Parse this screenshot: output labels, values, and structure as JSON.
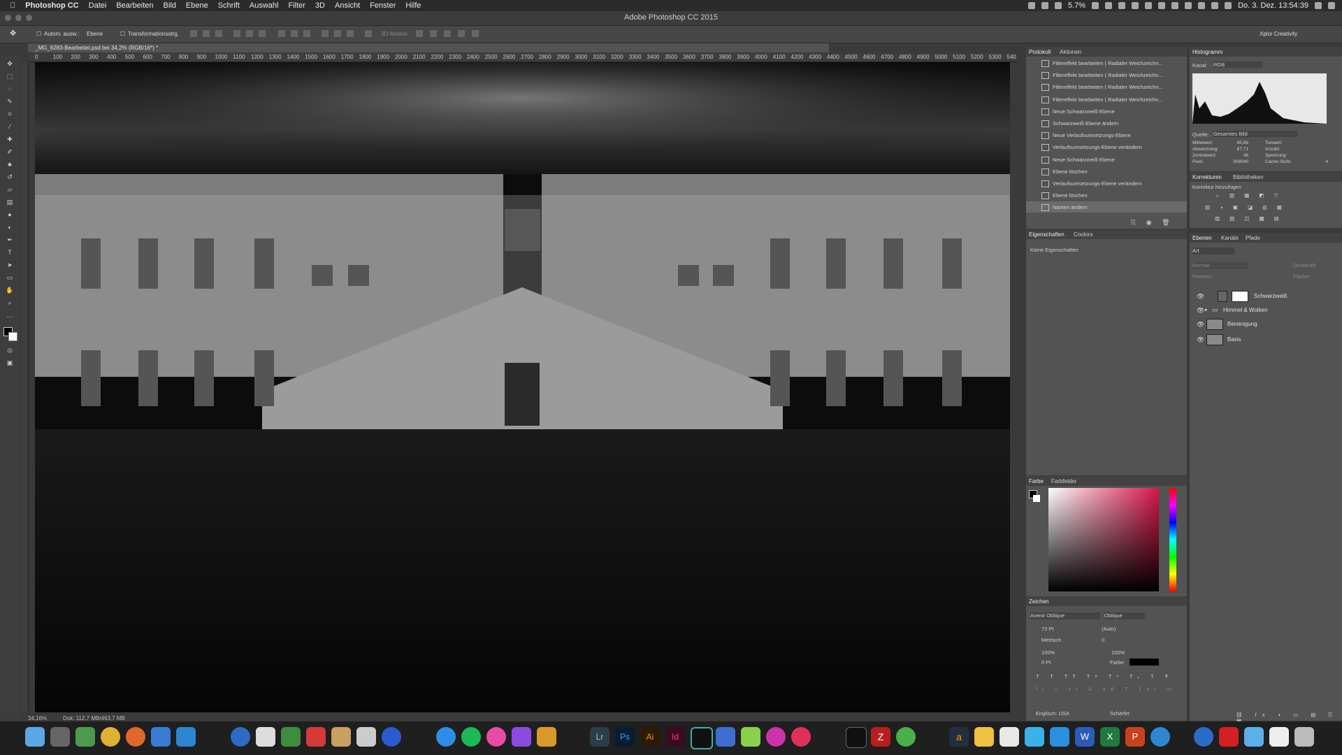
{
  "menubar": {
    "apple": "",
    "app": "Photoshop CC",
    "items": [
      "Datei",
      "Bearbeiten",
      "Bild",
      "Ebene",
      "Schrift",
      "Auswahl",
      "Filter",
      "3D",
      "Ansicht",
      "Fenster",
      "Hilfe"
    ],
    "battery": "5.7%",
    "datetime": "Do. 3. Dez.  13:54:39"
  },
  "window": {
    "title": "Adobe Photoshop CC 2015"
  },
  "options": {
    "auto_select": "Autom. ausw.:",
    "auto_select_value": "Ebene",
    "transform": "Transformationsstrg.",
    "mode3d": "3D-Modus:",
    "workspace": "Xplor Creativity"
  },
  "document": {
    "tab": "_MG_6283-Bearbeitet.psd bei 34,2% (RGB/16*) *",
    "zoom": "34,16%",
    "doc_info": "Dok: 112,7 MB/463,7 MB"
  },
  "ruler": {
    "h": [
      "0",
      "100",
      "200",
      "300",
      "400",
      "500",
      "600",
      "700",
      "800",
      "900",
      "1000",
      "1100",
      "1200",
      "1300",
      "1400",
      "1500",
      "1600",
      "1700",
      "1800",
      "1900",
      "2000",
      "2100",
      "2200",
      "2300",
      "2400",
      "2500",
      "2600",
      "2700",
      "2800",
      "2900",
      "3000",
      "3100",
      "3200",
      "3300",
      "3400",
      "3500",
      "3600",
      "3700",
      "3800",
      "3900",
      "4000",
      "4100",
      "4200",
      "4300",
      "4400",
      "4500",
      "4600",
      "4700",
      "4800",
      "4900",
      "5000",
      "5100",
      "5200",
      "5300",
      "540"
    ]
  },
  "history_panel": {
    "tabs": [
      "Protokoll",
      "Aktionen"
    ],
    "items": [
      "Filtereffekt bearbeiten ( Radialer Weichzeichn...",
      "Filtereffekt bearbeiten ( Radialer Weichzeichn...",
      "Filtereffekt bearbeiten ( Radialer Weichzeichn...",
      "Filtereffekt bearbeiten ( Radialer Weichzeichn...",
      "Neue Schwarzweiß-Ebene",
      "Schwarzweiß-Ebene ändern",
      "Neue Verlaufsumsetzungs-Ebene",
      "Verlaufsumsetzungs-Ebene verändern",
      "Neue Schwarzweiß-Ebene",
      "Ebene löschen",
      "Verlaufsumsetzungs-Ebene verändern",
      "Ebene löschen",
      "Namen ändern"
    ]
  },
  "properties_panel": {
    "tabs": [
      "Eigenschaften",
      "Coolors"
    ],
    "text": "Keine Eigenschaften"
  },
  "histogram_panel": {
    "title": "Histogramm",
    "channel_label": "Kanal:",
    "channel": "RGB",
    "source_label": "Quelle:",
    "source": "Gesamtes Bild",
    "stats_left": [
      [
        "Mittelwert:",
        "65,66"
      ],
      [
        "Abweichung:",
        "67,71"
      ],
      [
        "Zentralwert:",
        "48"
      ],
      [
        "Pixel:",
        "308040"
      ]
    ],
    "stats_right": [
      [
        "Tonwert:",
        ""
      ],
      [
        "Anzahl:",
        ""
      ],
      [
        "Spreizung:",
        ""
      ],
      [
        "Cache-Stufe:",
        "4"
      ]
    ]
  },
  "adjustments_panel": {
    "tabs": [
      "Korrekturen",
      "Bibliotheken"
    ],
    "text": "Korrektur hinzufügen"
  },
  "layers_panel": {
    "tabs": [
      "Ebenen",
      "Kanäle",
      "Pfade"
    ],
    "filter": "Art",
    "blend": "Normal",
    "opacity_label": "Deckkraft:",
    "lock_label": "Fixieren:",
    "fill_label": "Fläche:",
    "layers": [
      {
        "name": "Schwarzweiß"
      },
      {
        "name": "Himmel & Wolken"
      },
      {
        "name": "Bereinigung"
      },
      {
        "name": "Basis"
      }
    ]
  },
  "color_panel": {
    "tabs": [
      "Farbe",
      "Farbfelder"
    ]
  },
  "character_panel": {
    "title": "Zeichen",
    "font": "Avenir Oblique",
    "style": "Oblique",
    "size": "72 Pt",
    "leading": "(Auto)",
    "kerning": "Metrisch",
    "tracking": "0",
    "vscale": "100%",
    "hscale": "100%",
    "baseline": "0 Pt",
    "color_label": "Farbe:",
    "language": "Englisch: USA",
    "aa": "Schärfer"
  }
}
